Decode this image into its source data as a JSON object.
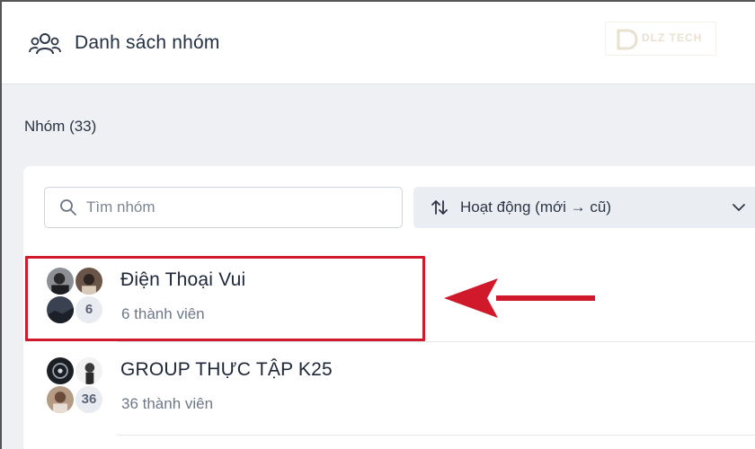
{
  "header": {
    "title": "Danh sách nhóm",
    "icon": "group-icon"
  },
  "watermark": {
    "text": "DLZ TECH"
  },
  "groups_count_label": "Nhóm (33)",
  "search": {
    "placeholder": "Tìm nhóm",
    "value": ""
  },
  "sort": {
    "label": "Hoạt động (mới → cũ)"
  },
  "groups": [
    {
      "name": "Điện Thoại Vui",
      "members": "6 thành viên",
      "extra_count": "6",
      "highlighted": true
    },
    {
      "name": "GROUP THỰC TẬP K25",
      "members": "36 thành viên",
      "extra_count": "36",
      "highlighted": false
    }
  ],
  "colors": {
    "highlight": "#d0192a",
    "background": "#eef0f4",
    "sort_bg": "#eaedf1"
  }
}
